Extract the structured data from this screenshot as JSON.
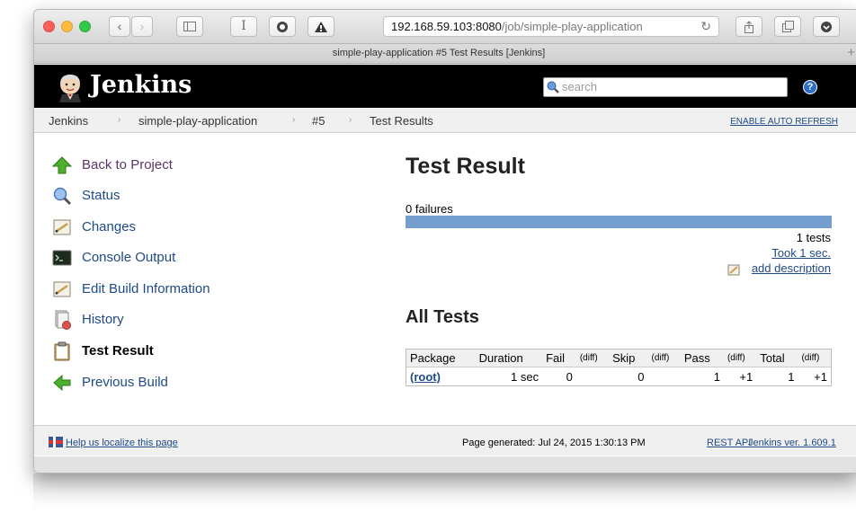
{
  "browser": {
    "url_host": "192.168.59.103:8080",
    "url_path": "/job/simple-play-application",
    "tab_title": "simple-play-application #5 Test Results [Jenkins]"
  },
  "header": {
    "brand": "Jenkins",
    "search_placeholder": "search",
    "help_label": "?"
  },
  "breadcrumb": {
    "items": [
      "Jenkins",
      "simple-play-application",
      "#5",
      "Test Results"
    ],
    "separator": "›",
    "auto_refresh": "ENABLE AUTO REFRESH"
  },
  "sidebar": {
    "items": [
      {
        "label": "Back to Project",
        "icon": "up-arrow-icon"
      },
      {
        "label": "Status",
        "icon": "magnifier-icon"
      },
      {
        "label": "Changes",
        "icon": "notepad-icon"
      },
      {
        "label": "Console Output",
        "icon": "terminal-icon"
      },
      {
        "label": "Edit Build Information",
        "icon": "notepad-icon"
      },
      {
        "label": "History",
        "icon": "history-icon"
      },
      {
        "label": "Test Result",
        "icon": "clipboard-icon"
      },
      {
        "label": "Previous Build",
        "icon": "left-arrow-icon"
      }
    ]
  },
  "main": {
    "title": "Test Result",
    "failures": "0 failures",
    "tests_count": "1 tests",
    "took": "Took 1 sec.",
    "add_description": "add description",
    "all_tests_title": "All Tests",
    "pass_fraction": 1.0,
    "table": {
      "headers": [
        "Package",
        "Duration",
        "Fail",
        "(diff)",
        "Skip",
        "(diff)",
        "Pass",
        "(diff)",
        "Total",
        "(diff)"
      ],
      "rows": [
        [
          "(root)",
          "1 sec",
          "0",
          "",
          "0",
          "",
          "1",
          "+1",
          "1",
          "+1"
        ]
      ]
    }
  },
  "footer": {
    "localize": "Help us localize this page",
    "generated": "Page generated: Jul 24, 2015 1:30:13 PM",
    "rest_api": "REST API",
    "version": "Jenkins ver. 1.609.1"
  },
  "colors": {
    "bar": "#729fcf",
    "link": "#204a87",
    "header_bg": "#000000"
  }
}
